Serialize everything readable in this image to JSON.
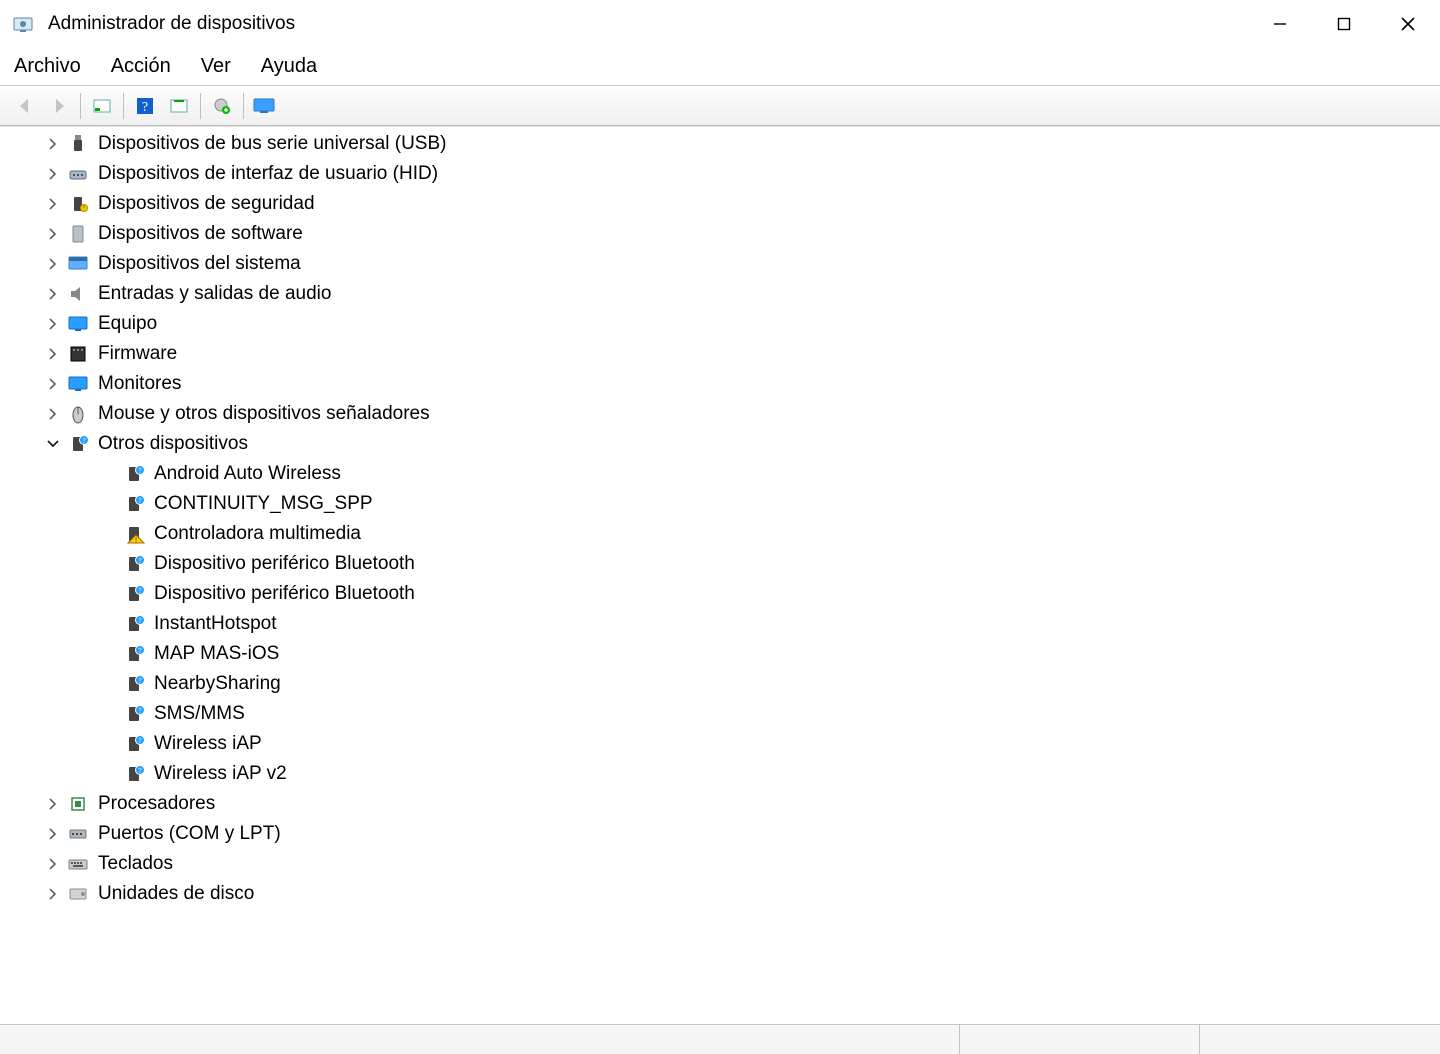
{
  "window": {
    "title": "Administrador de dispositivos"
  },
  "menu": {
    "items": [
      "Archivo",
      "Acción",
      "Ver",
      "Ayuda"
    ]
  },
  "tree": {
    "nodes": [
      {
        "label": "Dispositivos de bus serie universal (USB)",
        "icon": "usb",
        "expanded": false,
        "children": []
      },
      {
        "label": "Dispositivos de interfaz de usuario (HID)",
        "icon": "hid",
        "expanded": false,
        "children": []
      },
      {
        "label": "Dispositivos de seguridad",
        "icon": "security",
        "expanded": false,
        "children": []
      },
      {
        "label": "Dispositivos de software",
        "icon": "software",
        "expanded": false,
        "children": []
      },
      {
        "label": "Dispositivos del sistema",
        "icon": "system",
        "expanded": false,
        "children": []
      },
      {
        "label": "Entradas y salidas de audio",
        "icon": "audio",
        "expanded": false,
        "children": []
      },
      {
        "label": "Equipo",
        "icon": "monitor-blue",
        "expanded": false,
        "children": []
      },
      {
        "label": "Firmware",
        "icon": "firmware",
        "expanded": false,
        "children": []
      },
      {
        "label": "Monitores",
        "icon": "monitor-blue",
        "expanded": false,
        "children": []
      },
      {
        "label": "Mouse y otros dispositivos señaladores",
        "icon": "mouse",
        "expanded": false,
        "children": []
      },
      {
        "label": "Otros dispositivos",
        "icon": "unknown",
        "expanded": true,
        "children": [
          {
            "label": "Android Auto Wireless",
            "icon": "unknown"
          },
          {
            "label": "CONTINUITY_MSG_SPP",
            "icon": "unknown"
          },
          {
            "label": "Controladora multimedia",
            "icon": "unknown-warning"
          },
          {
            "label": "Dispositivo periférico Bluetooth",
            "icon": "unknown"
          },
          {
            "label": "Dispositivo periférico Bluetooth",
            "icon": "unknown"
          },
          {
            "label": "InstantHotspot",
            "icon": "unknown"
          },
          {
            "label": "MAP MAS-iOS",
            "icon": "unknown"
          },
          {
            "label": "NearbySharing",
            "icon": "unknown"
          },
          {
            "label": "SMS/MMS",
            "icon": "unknown"
          },
          {
            "label": "Wireless iAP",
            "icon": "unknown"
          },
          {
            "label": "Wireless iAP v2",
            "icon": "unknown"
          }
        ]
      },
      {
        "label": "Procesadores",
        "icon": "cpu",
        "expanded": false,
        "children": []
      },
      {
        "label": "Puertos (COM y LPT)",
        "icon": "port",
        "expanded": false,
        "children": []
      },
      {
        "label": "Teclados",
        "icon": "keyboard",
        "expanded": false,
        "children": []
      },
      {
        "label": "Unidades de disco",
        "icon": "disk",
        "expanded": false,
        "children": []
      }
    ]
  }
}
